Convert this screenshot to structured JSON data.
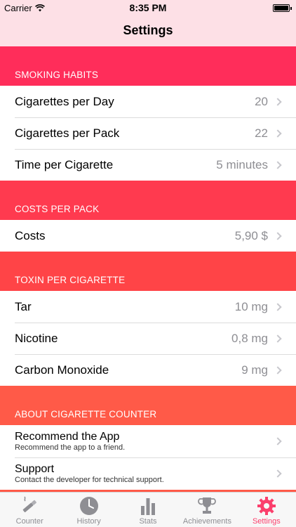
{
  "status": {
    "carrier": "Carrier",
    "time": "8:35 PM"
  },
  "nav": {
    "title": "Settings"
  },
  "colors": {
    "habits": "#ff2d5a",
    "costs": "#ff3a4f",
    "toxin": "#ff4447",
    "about": "#ff5a48",
    "active_tab": "#fb3f6c"
  },
  "sections": {
    "habits": {
      "header": "SMOKING HABITS",
      "rows": [
        {
          "label": "Cigarettes per Day",
          "value": "20"
        },
        {
          "label": "Cigarettes per Pack",
          "value": "22"
        },
        {
          "label": "Time per Cigarette",
          "value": "5 minutes"
        }
      ]
    },
    "costs": {
      "header": "COSTS PER PACK",
      "rows": [
        {
          "label": "Costs",
          "value": "5,90 $"
        }
      ]
    },
    "toxin": {
      "header": "TOXIN PER CIGARETTE",
      "rows": [
        {
          "label": "Tar",
          "value": "10 mg"
        },
        {
          "label": "Nicotine",
          "value": "0,8 mg"
        },
        {
          "label": "Carbon Monoxide",
          "value": "9 mg"
        }
      ]
    },
    "about": {
      "header": "ABOUT CIGARETTE COUNTER",
      "rows": [
        {
          "label": "Recommend the App",
          "sub": "Recommend the app to a friend."
        },
        {
          "label": "Support",
          "sub": "Contact the developer for technical support."
        }
      ]
    }
  },
  "tabs": [
    {
      "label": "Counter",
      "icon": "cigarette-icon"
    },
    {
      "label": "History",
      "icon": "clock-icon"
    },
    {
      "label": "Stats",
      "icon": "bar-chart-icon"
    },
    {
      "label": "Achievements",
      "icon": "trophy-icon"
    },
    {
      "label": "Settings",
      "icon": "gear-icon",
      "active": true
    }
  ]
}
